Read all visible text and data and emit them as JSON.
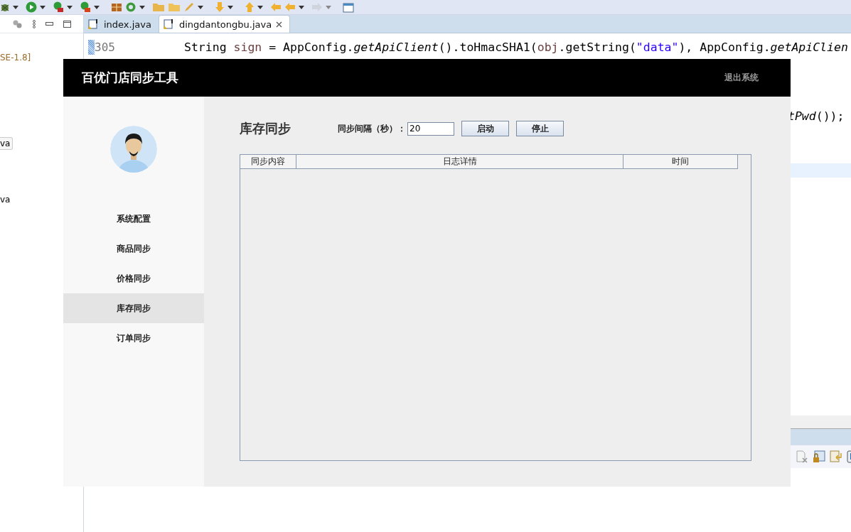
{
  "ide": {
    "explorer_items": [
      {
        "label": "SE-1.8]",
        "kind": "library",
        "selected": false
      },
      {
        "label": "va",
        "kind": "file",
        "selected": true
      },
      {
        "label": "va",
        "kind": "file",
        "selected": false
      }
    ],
    "editor_tabs": [
      {
        "label": "index.java",
        "selected": false,
        "closable": false
      },
      {
        "label": "dingdantongbu.java",
        "selected": true,
        "closable": true
      }
    ],
    "code_lines": [
      {
        "number": "305",
        "tokens": [
          {
            "text": "String ",
            "kind": "plain"
          },
          {
            "text": "sign",
            "kind": "local"
          },
          {
            "text": " = AppConfig.",
            "kind": "plain"
          },
          {
            "text": "getApiClient",
            "kind": "static"
          },
          {
            "text": "().toHmacSHA1(",
            "kind": "plain"
          },
          {
            "text": "obj",
            "kind": "local"
          },
          {
            "text": ".getString(",
            "kind": "plain"
          },
          {
            "text": "\"data\"",
            "kind": "string"
          },
          {
            "text": "), AppConfig.",
            "kind": "plain"
          },
          {
            "text": "getApiClien",
            "kind": "static"
          }
        ]
      }
    ],
    "code_fragment": [
      {
        "text": "tPwd",
        "kind": "static"
      },
      {
        "text": "());",
        "kind": "plain"
      }
    ]
  },
  "app": {
    "title": "百优门店同步工具",
    "logout": "退出系统",
    "nav": [
      {
        "label": "系统配置",
        "selected": false
      },
      {
        "label": "商品同步",
        "selected": false
      },
      {
        "label": "价格同步",
        "selected": false
      },
      {
        "label": "库存同步",
        "selected": true
      },
      {
        "label": "订单同步",
        "selected": false
      }
    ],
    "page_title": "库存同步",
    "interval_label": "同步间隔（秒）：",
    "interval_value": "20",
    "buttons": [
      "启动",
      "停止"
    ],
    "table": {
      "columns": [
        "同步内容",
        "日志详情",
        "时间"
      ]
    }
  }
}
